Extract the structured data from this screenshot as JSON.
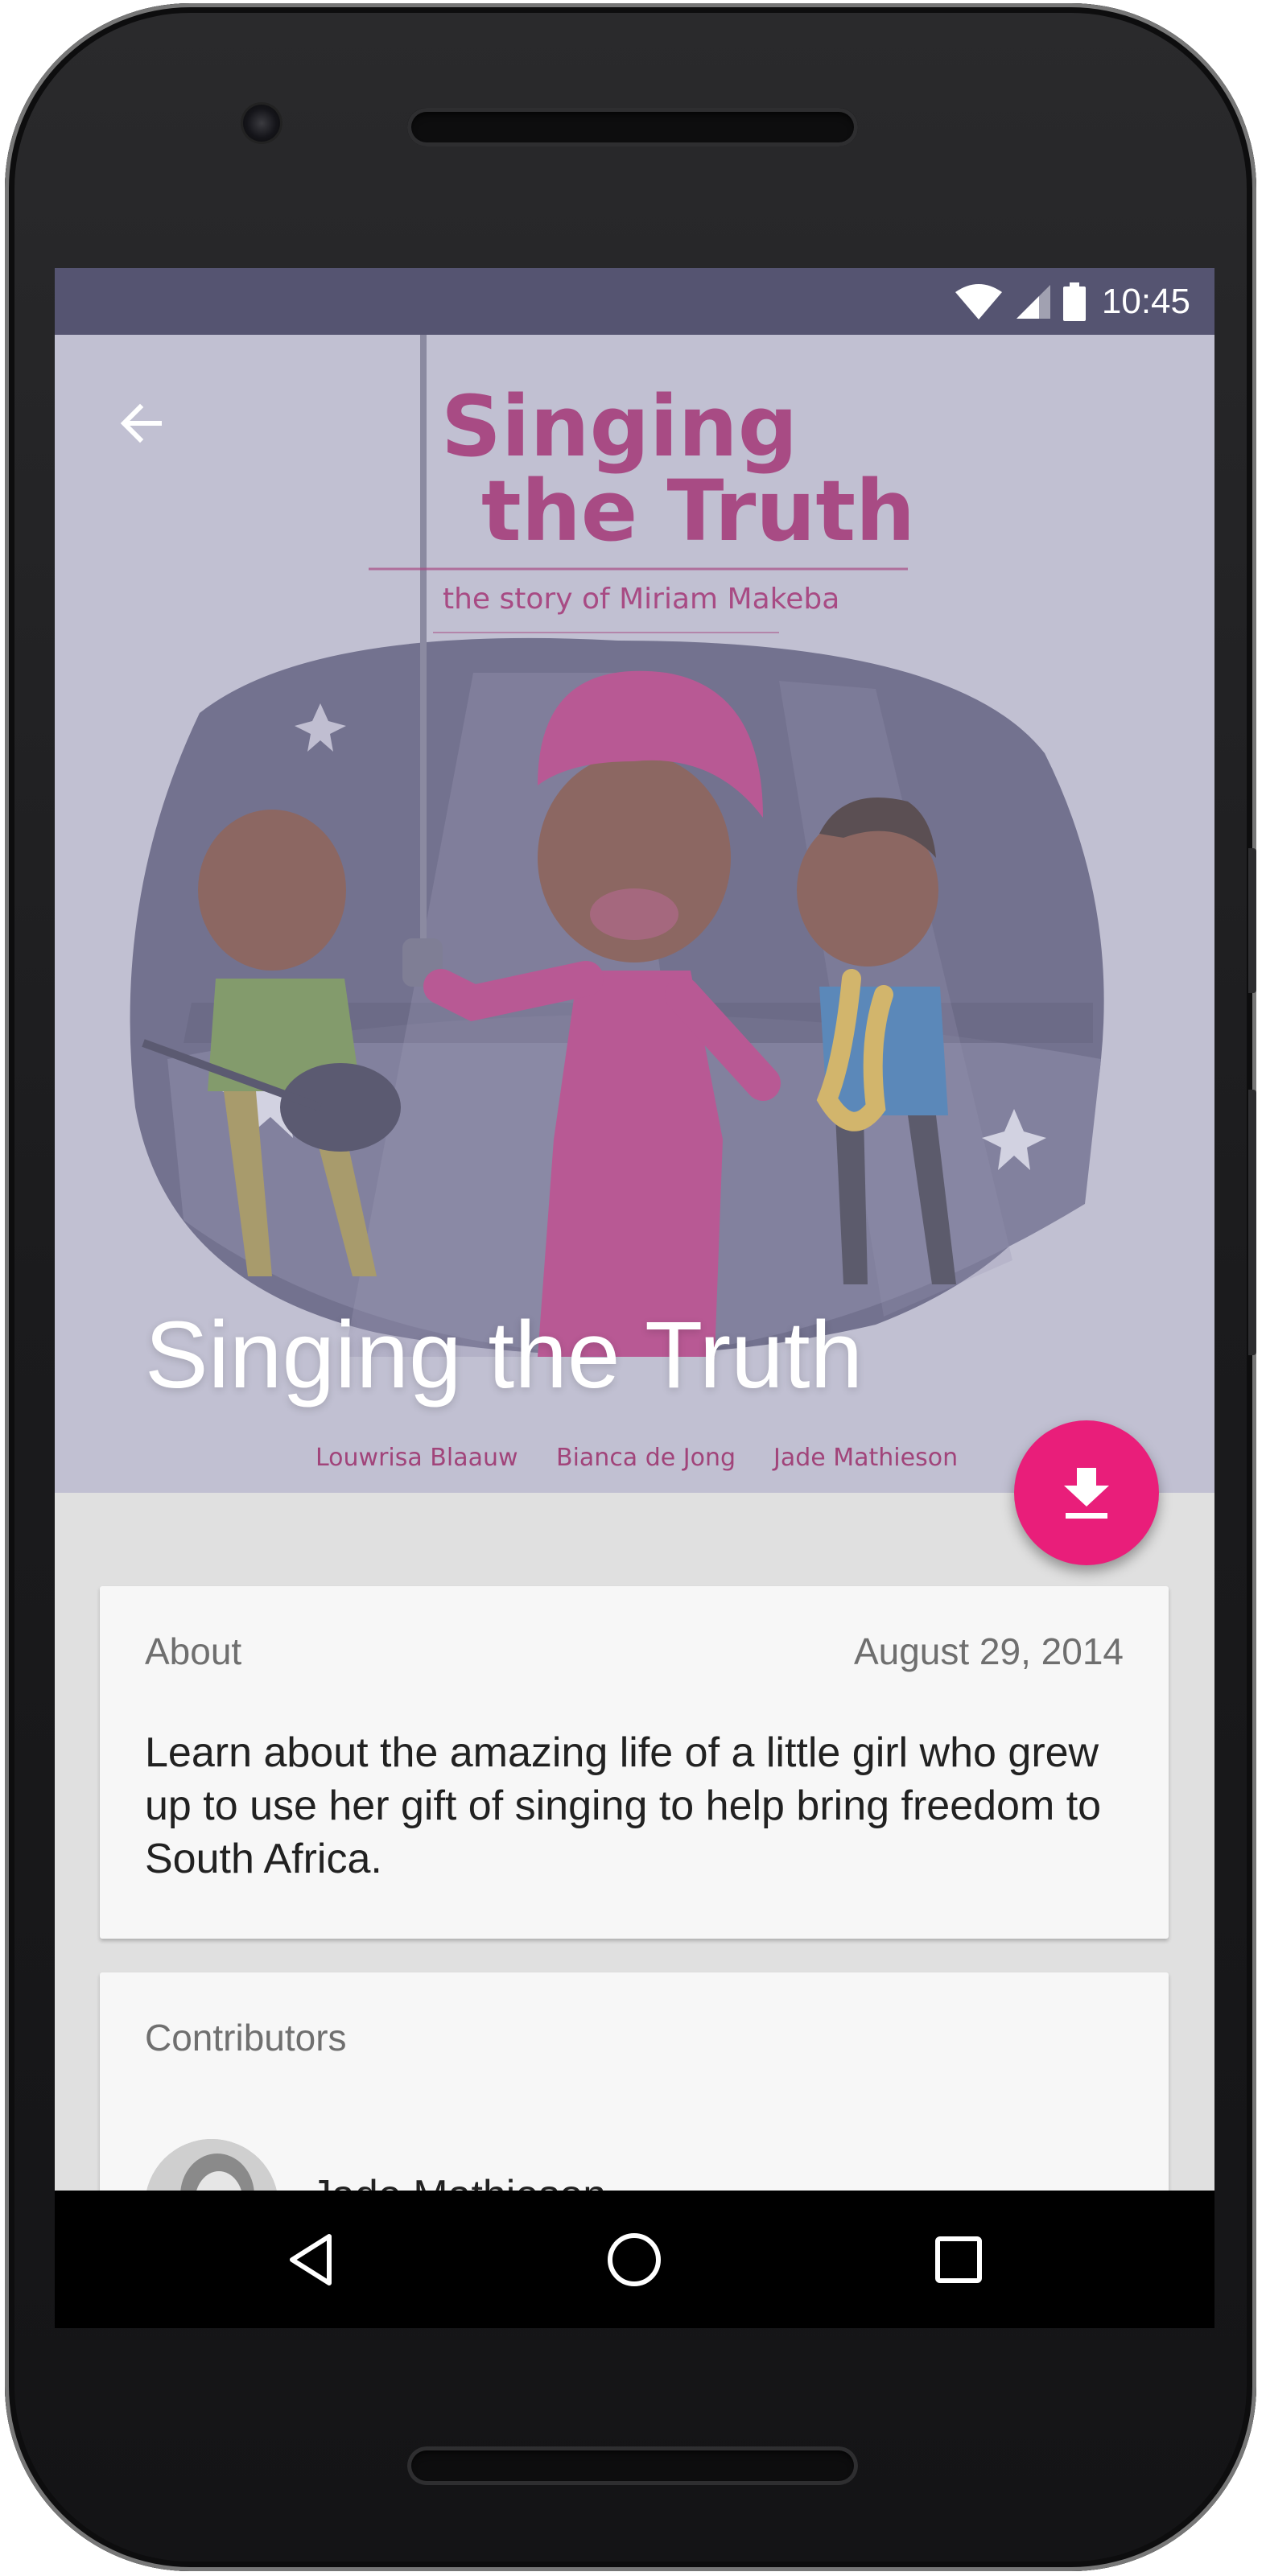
{
  "status_bar": {
    "time": "10:45",
    "icons": [
      "wifi-icon",
      "cellular-signal-icon",
      "battery-icon"
    ]
  },
  "book": {
    "title": "Singing the Truth",
    "cover_title_line1": "Singing",
    "cover_title_line2": "the Truth",
    "cover_subtitle": "the story of Miriam Makeba",
    "credits": [
      "Louwrisa Blaauw",
      "Bianca de Jong",
      "Jade Mathieson"
    ]
  },
  "actions": {
    "back_icon": "arrow-back-icon",
    "download_icon": "download-icon"
  },
  "about_card": {
    "label": "About",
    "date": "August 29, 2014",
    "description": "Learn about the amazing life of a little girl who grew up to use her gift of singing to help bring freedom to South Africa."
  },
  "contributors_card": {
    "label": "Contributors",
    "items": [
      {
        "name": "Jade Mathieson"
      }
    ]
  },
  "nav_bar": {
    "icons": [
      "back-triangle-icon",
      "home-circle-icon",
      "recents-square-icon"
    ]
  },
  "colors": {
    "status_bar": "#555471",
    "hero_background": "#c2c1d2",
    "accent": "#e91e7a",
    "cover_title": "#a1256a"
  }
}
